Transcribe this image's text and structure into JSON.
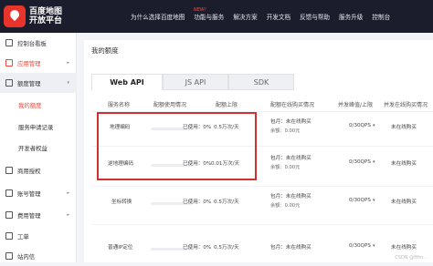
{
  "header": {
    "logo_line1": "百度地图",
    "logo_line2": "开放平台",
    "new_badge": "NEW!",
    "nav": [
      "为什么选择百度地图",
      "功能与服务",
      "解决方案",
      "开发文档",
      "反馈与帮助",
      "服务升级",
      "控制台"
    ]
  },
  "sidebar": {
    "items": [
      {
        "label": "控制台看板",
        "icon": "dashboard-icon"
      },
      {
        "label": "应用管理",
        "icon": "app-icon",
        "arrow": "▸"
      },
      {
        "label": "额度管理",
        "icon": "quota-icon",
        "arrow": "▾"
      },
      {
        "label": "商用授权",
        "icon": "license-icon"
      },
      {
        "label": "账号管理",
        "icon": "account-icon",
        "arrow": "▸"
      },
      {
        "label": "费用管理",
        "icon": "billing-icon",
        "arrow": "▸"
      },
      {
        "label": "工单",
        "icon": "ticket-icon"
      },
      {
        "label": "站内信",
        "icon": "message-icon"
      }
    ],
    "sub_items": [
      "我的额度",
      "服务申请记录",
      "开发者权益"
    ]
  },
  "main": {
    "title": "我的额度",
    "tabs": [
      "Web API",
      "JS API",
      "SDK"
    ],
    "columns": [
      "服务名称",
      "配额使用情况",
      "配额上限",
      "配额在线购买情况",
      "并发峰值/上限",
      "并发在线购买情况"
    ],
    "rows": [
      {
        "name": "地理编码",
        "used": "已使用：0%",
        "limit": "0.5万次/天",
        "buy1": "包月：未在线购买",
        "buy2": "余额：0.00元",
        "qps": "0/30QPS",
        "qps_buy": "未在线购买",
        "usage_fraction": 0.0
      },
      {
        "name": "逆地理编码",
        "used": "已使用：0%",
        "limit": "0.01万次/天",
        "buy1": "包月：未在线购买",
        "buy2": "余额：0.00元",
        "qps": "0/30QPS",
        "qps_buy": "未在线购买",
        "usage_fraction": 0.0
      },
      {
        "name": "坐标转换",
        "used": "已使用：0%",
        "limit": "0.5万次/天",
        "buy1": "包月：未在线购买",
        "buy2": "余额：0.00元",
        "qps": "0/30QPS",
        "qps_buy": "未在线购买",
        "usage_fraction": 0.0
      },
      {
        "name": "普通IP定位",
        "used": "已使用：0%",
        "limit": "0.5万次/天",
        "buy1": "包月：未在线购买",
        "buy2": "",
        "qps": "0/30QPS",
        "qps_buy": "未在线购买",
        "usage_fraction": 0.0
      }
    ]
  },
  "watermark": "CSDN @fffm..."
}
